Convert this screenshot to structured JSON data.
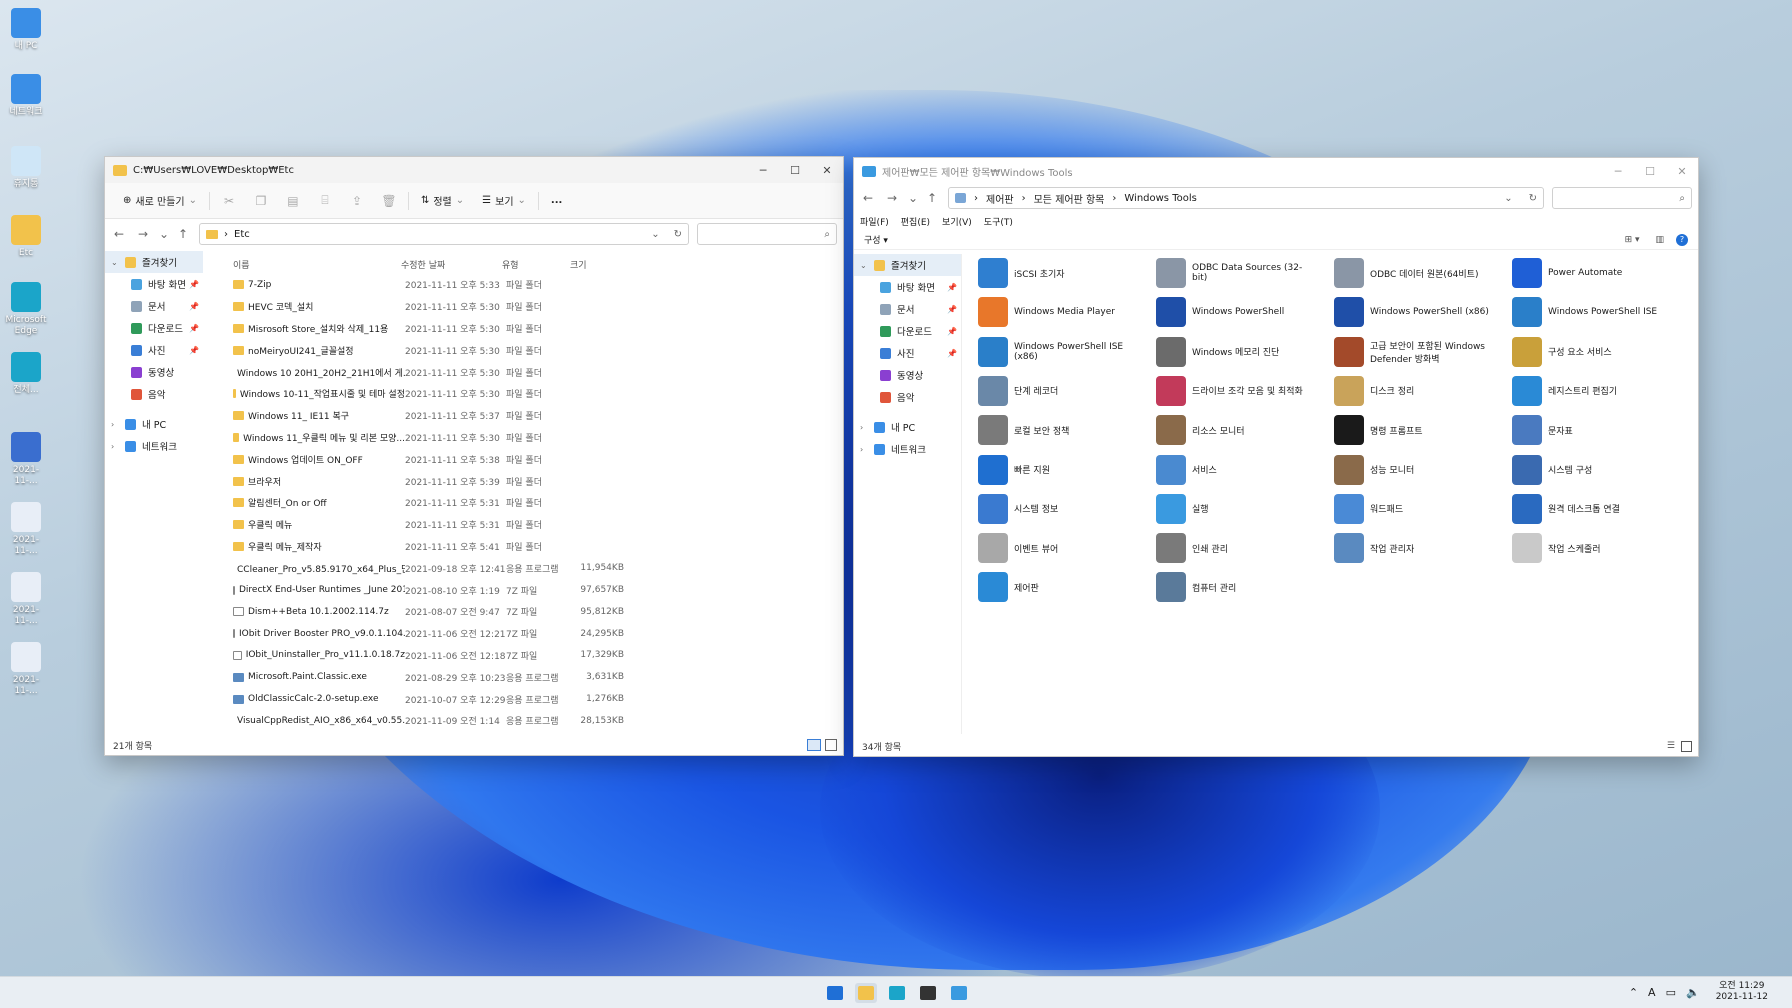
{
  "desktop": {
    "icons": [
      {
        "label": "내 PC",
        "color": "#3a8ee6"
      },
      {
        "label": "네트워크",
        "color": "#3a8ee6"
      },
      {
        "label": "휴지통",
        "color": "#cfe6f7"
      },
      {
        "label": "Etc",
        "color": "#f2c24b"
      },
      {
        "label": "Microsoft Edge",
        "color": "#1ba5c9"
      },
      {
        "label": "전체...",
        "color": "#1ba5c9"
      },
      {
        "label": "2021-11-...",
        "color": "#3a6ecf"
      },
      {
        "label": "2021-11-...",
        "color": "#e8eef7"
      },
      {
        "label": "2021-11-...",
        "color": "#e8eef7"
      },
      {
        "label": "2021-11-...",
        "color": "#e8eef7"
      }
    ]
  },
  "explorer1": {
    "title": "C:₩Users₩LOVE₩Desktop₩Etc",
    "toolbar": {
      "new": "새로 만들기",
      "sort": "정렬",
      "view": "보기",
      "more": "..."
    },
    "address": "Etc",
    "columns": [
      "이름",
      "수정한 날짜",
      "유형",
      "크기"
    ],
    "sidebar": [
      {
        "label": "즐겨찾기",
        "level": 0,
        "color": "#f2c24b",
        "pin": false
      },
      {
        "label": "바탕 화면",
        "level": 1,
        "color": "#4aa3df",
        "pin": true
      },
      {
        "label": "문서",
        "level": 1,
        "color": "#8fa3b8",
        "pin": true
      },
      {
        "label": "다운로드",
        "level": 1,
        "color": "#2f9a5a",
        "pin": true
      },
      {
        "label": "사진",
        "level": 1,
        "color": "#3a7ed6",
        "pin": true
      },
      {
        "label": "동영상",
        "level": 1,
        "color": "#8a3fd1",
        "pin": false
      },
      {
        "label": "음악",
        "level": 1,
        "color": "#e0553a",
        "pin": false
      },
      {
        "label": "내 PC",
        "level": 0,
        "color": "#3a8ee6",
        "pin": false
      },
      {
        "label": "네트워크",
        "level": 0,
        "color": "#3a8ee6",
        "pin": false
      }
    ],
    "files": [
      {
        "name": "7-Zip",
        "date": "2021-11-11 오후 5:33",
        "type": "파일 폴더",
        "size": "",
        "kind": "folder"
      },
      {
        "name": "HEVC 코덱_설치",
        "date": "2021-11-11 오후 5:30",
        "type": "파일 폴더",
        "size": "",
        "kind": "folder"
      },
      {
        "name": "Misrosoft Store_설치와 삭제_11용",
        "date": "2021-11-11 오후 5:30",
        "type": "파일 폴더",
        "size": "",
        "kind": "folder"
      },
      {
        "name": "noMeiryoUI241_글꼴설정",
        "date": "2021-11-11 오후 5:30",
        "type": "파일 폴더",
        "size": "",
        "kind": "folder"
      },
      {
        "name": "Windows 10 20H1_20H2_21H1에서 게...",
        "date": "2021-11-11 오후 5:30",
        "type": "파일 폴더",
        "size": "",
        "kind": "folder"
      },
      {
        "name": "Windows 10-11_작업표시줄 및 테마 설정",
        "date": "2021-11-11 오후 5:30",
        "type": "파일 폴더",
        "size": "",
        "kind": "folder"
      },
      {
        "name": "Windows 11_ IE11 복구",
        "date": "2021-11-11 오후 5:37",
        "type": "파일 폴더",
        "size": "",
        "kind": "folder"
      },
      {
        "name": "Windows 11_우클릭 메뉴 및 리본 모양...",
        "date": "2021-11-11 오후 5:30",
        "type": "파일 폴더",
        "size": "",
        "kind": "folder"
      },
      {
        "name": "Windows 업데이트 ON_OFF",
        "date": "2021-11-11 오후 5:38",
        "type": "파일 폴더",
        "size": "",
        "kind": "folder"
      },
      {
        "name": "브라우저",
        "date": "2021-11-11 오후 5:39",
        "type": "파일 폴더",
        "size": "",
        "kind": "folder"
      },
      {
        "name": "알림센터_On or Off",
        "date": "2021-11-11 오후 5:31",
        "type": "파일 폴더",
        "size": "",
        "kind": "folder"
      },
      {
        "name": "우클릭 메뉴",
        "date": "2021-11-11 오후 5:31",
        "type": "파일 폴더",
        "size": "",
        "kind": "folder"
      },
      {
        "name": "우클릭 메뉴_제작자",
        "date": "2021-11-11 오후 5:41",
        "type": "파일 폴더",
        "size": "",
        "kind": "folder"
      },
      {
        "name": "CCleaner_Pro_v5.85.9170_x64_Plus_단...",
        "date": "2021-09-18 오후 12:41",
        "type": "응용 프로그램",
        "size": "11,954KB",
        "kind": "app"
      },
      {
        "name": "DirectX End-User Runtimes _June 2010.7z",
        "date": "2021-08-10 오후 1:19",
        "type": "7Z 파일",
        "size": "97,657KB",
        "kind": "file"
      },
      {
        "name": "Dism++Beta 10.1.2002.114.7z",
        "date": "2021-08-07 오전 9:47",
        "type": "7Z 파일",
        "size": "95,812KB",
        "kind": "file"
      },
      {
        "name": "IObit Driver Booster PRO_v9.0.1.104.7z",
        "date": "2021-11-06 오전 12:21",
        "type": "7Z 파일",
        "size": "24,295KB",
        "kind": "file"
      },
      {
        "name": "IObit_Uninstaller_Pro_v11.1.0.18.7z",
        "date": "2021-11-06 오전 12:18",
        "type": "7Z 파일",
        "size": "17,329KB",
        "kind": "file"
      },
      {
        "name": "Microsoft.Paint.Classic.exe",
        "date": "2021-08-29 오후 10:23",
        "type": "응용 프로그램",
        "size": "3,631KB",
        "kind": "app"
      },
      {
        "name": "OldClassicCalc-2.0-setup.exe",
        "date": "2021-10-07 오후 12:29",
        "type": "응용 프로그램",
        "size": "1,276KB",
        "kind": "app"
      },
      {
        "name": "VisualCppRedist_AIO_x86_x64_v0.55.0_...",
        "date": "2021-11-09 오전 1:14",
        "type": "응용 프로그램",
        "size": "28,153KB",
        "kind": "app"
      }
    ],
    "status": "21개 항목"
  },
  "explorer2": {
    "title": "제어판₩모든 제어판 항목₩Windows Tools",
    "breadcrumb": [
      "제어판",
      "모든 제어판 항목",
      "Windows Tools"
    ],
    "menu": [
      "파일(F)",
      "편집(E)",
      "보기(V)",
      "도구(T)"
    ],
    "organize": "구성",
    "sidebar": [
      {
        "label": "즐겨찾기",
        "level": 0,
        "color": "#f2c24b",
        "pin": false
      },
      {
        "label": "바탕 화면",
        "level": 1,
        "color": "#4aa3df",
        "pin": true
      },
      {
        "label": "문서",
        "level": 1,
        "color": "#8fa3b8",
        "pin": true
      },
      {
        "label": "다운로드",
        "level": 1,
        "color": "#2f9a5a",
        "pin": true
      },
      {
        "label": "사진",
        "level": 1,
        "color": "#3a7ed6",
        "pin": true
      },
      {
        "label": "동영상",
        "level": 1,
        "color": "#8a3fd1",
        "pin": false
      },
      {
        "label": "음악",
        "level": 1,
        "color": "#e0553a",
        "pin": false
      },
      {
        "label": "내 PC",
        "level": 0,
        "color": "#3a8ee6",
        "pin": false
      },
      {
        "label": "네트워크",
        "level": 0,
        "color": "#3a8ee6",
        "pin": false
      }
    ],
    "tools": [
      {
        "label": "iSCSI 초기자",
        "color": "#2f7fd0"
      },
      {
        "label": "ODBC Data Sources (32-bit)",
        "color": "#8a96a6"
      },
      {
        "label": "ODBC 데이터 원본(64비트)",
        "color": "#8a96a6"
      },
      {
        "label": "Power Automate",
        "color": "#1f5fd6"
      },
      {
        "label": "Windows Media Player",
        "color": "#e8772a"
      },
      {
        "label": "Windows PowerShell",
        "color": "#1f4fa8"
      },
      {
        "label": "Windows PowerShell (x86)",
        "color": "#1f4fa8"
      },
      {
        "label": "Windows PowerShell ISE",
        "color": "#2a7fc9"
      },
      {
        "label": "Windows PowerShell ISE (x86)",
        "color": "#2a7fc9"
      },
      {
        "label": "Windows 메모리 진단",
        "color": "#6b6b6b"
      },
      {
        "label": "고급 보안이 포함된 Windows Defender 방화벽",
        "color": "#a34a2a"
      },
      {
        "label": "구성 요소 서비스",
        "color": "#c9a03a"
      },
      {
        "label": "단계 레코더",
        "color": "#6a88a8"
      },
      {
        "label": "드라이브 조각 모음 및 최적화",
        "color": "#c23a5a"
      },
      {
        "label": "디스크 정리",
        "color": "#c9a35a"
      },
      {
        "label": "레지스트리 편집기",
        "color": "#2a8ad6"
      },
      {
        "label": "로컬 보안 정책",
        "color": "#7a7a7a"
      },
      {
        "label": "리소스 모니터",
        "color": "#8a6a4a"
      },
      {
        "label": "명령 프롬프트",
        "color": "#1a1a1a"
      },
      {
        "label": "문자표",
        "color": "#4a7ac0"
      },
      {
        "label": "빠른 지원",
        "color": "#1f6fd0"
      },
      {
        "label": "서비스",
        "color": "#4a8ad0"
      },
      {
        "label": "성능 모니터",
        "color": "#8a6a4a"
      },
      {
        "label": "시스템 구성",
        "color": "#3a6ab0"
      },
      {
        "label": "시스템 정보",
        "color": "#3a7ad0"
      },
      {
        "label": "실행",
        "color": "#3a9ae0"
      },
      {
        "label": "워드패드",
        "color": "#4a8ad6"
      },
      {
        "label": "원격 데스크톱 연결",
        "color": "#2a6ac0"
      },
      {
        "label": "이벤트 뷰어",
        "color": "#a8a8a8"
      },
      {
        "label": "인쇄 관리",
        "color": "#7a7a7a"
      },
      {
        "label": "작업 관리자",
        "color": "#5a8ac0"
      },
      {
        "label": "작업 스케줄러",
        "color": "#c9c9c9"
      },
      {
        "label": "제어판",
        "color": "#2a8ad6"
      },
      {
        "label": "컴퓨터 관리",
        "color": "#5a7a9a"
      }
    ],
    "status": "34개 항목"
  },
  "taskbar": {
    "apps": [
      {
        "name": "start",
        "color": "#1f6fd6"
      },
      {
        "name": "file-explorer",
        "color": "#f2c24b"
      },
      {
        "name": "edge",
        "color": "#1ba5c9"
      },
      {
        "name": "store",
        "color": "#333"
      },
      {
        "name": "control-panel",
        "color": "#3a9ae0"
      }
    ],
    "ime": "A",
    "time": "오전 11:29",
    "date": "2021-11-12"
  }
}
